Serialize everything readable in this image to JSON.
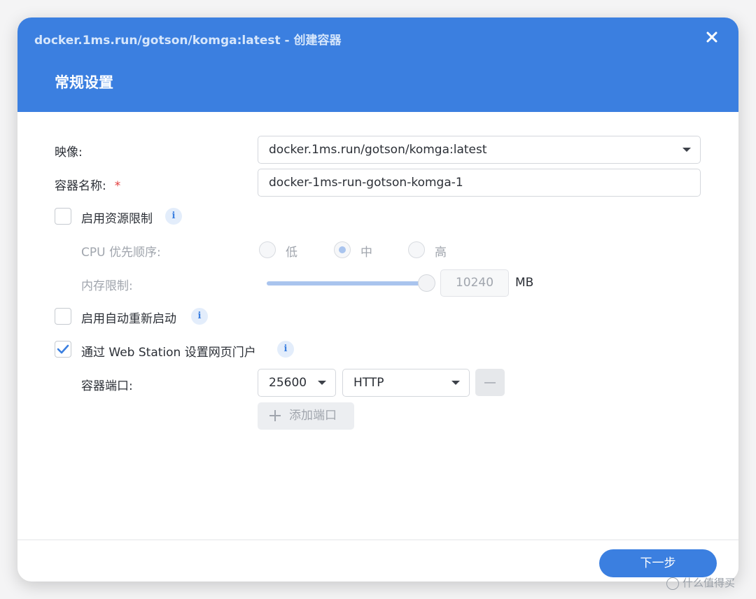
{
  "window": {
    "title": "docker.1ms.run/gotson/komga:latest - 创建容器",
    "heading": "常规设置",
    "close_icon": "close-icon"
  },
  "form": {
    "image_label": "映像:",
    "image_value": "docker.1ms.run/gotson/komga:latest",
    "name_label": "容器名称:",
    "required_mark": "*",
    "name_value": "docker-1ms-run-gotson-komga-1",
    "resource_limit": {
      "label": "启用资源限制",
      "checked": false
    },
    "cpu_priority": {
      "label": "CPU 优先顺序:",
      "options": [
        "低",
        "中",
        "高"
      ],
      "selected": "中"
    },
    "memory_limit": {
      "label": "内存限制:",
      "value": "10240",
      "unit": "MB",
      "level": 1.0
    },
    "auto_restart": {
      "label": "启用自动重新启动",
      "checked": false
    },
    "web_station": {
      "label": "通过 Web Station 设置网页门户",
      "checked": true
    },
    "port": {
      "label": "容器端口:",
      "value": "25600",
      "protocol": "HTTP",
      "add_label": "添加端口"
    },
    "info_glyph": "i"
  },
  "footer": {
    "next_label": "下一步"
  },
  "watermark": {
    "text": "什么值得买"
  },
  "colors": {
    "accent": "#3b7fe0",
    "checkbox_check": "#3b7fe0",
    "required": "#e23b3b"
  }
}
